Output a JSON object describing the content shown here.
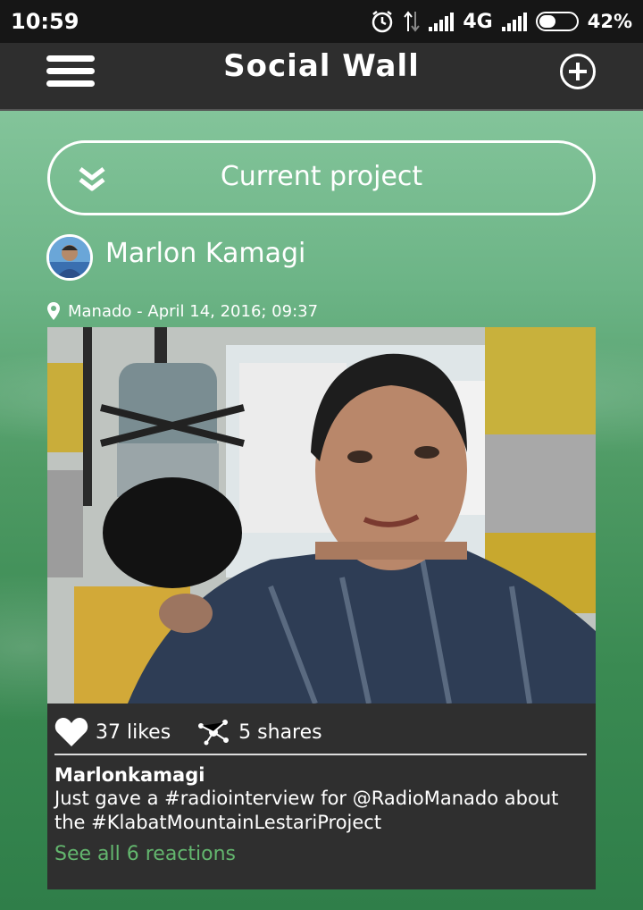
{
  "status_bar": {
    "time": "10:59",
    "network": "4G",
    "battery": "42%",
    "battery_level": 0.42
  },
  "header": {
    "title": "Social Wall",
    "menu_icon": "hamburger-menu-icon",
    "add_icon": "plus-circle-icon"
  },
  "project_selector": {
    "label": "Current project",
    "icon": "double-chevron-down-icon"
  },
  "post": {
    "user_name": "Marlon Kamagi",
    "location": "Manado - April 14, 2016; 09:37",
    "likes": "37 likes",
    "shares": "5 shares",
    "author": "Marlonkamagi",
    "text": "Just gave a #radiointerview for @RadioManado about the #KlabatMountainLestariProject",
    "reactions_link": "See all 6 reactions"
  },
  "colors": {
    "status_bar": "#161616",
    "app_bar": "#2e2e2e",
    "post_box": "#2f2f2f",
    "link_green": "#63b66e",
    "background_green": "#4e9a64"
  }
}
